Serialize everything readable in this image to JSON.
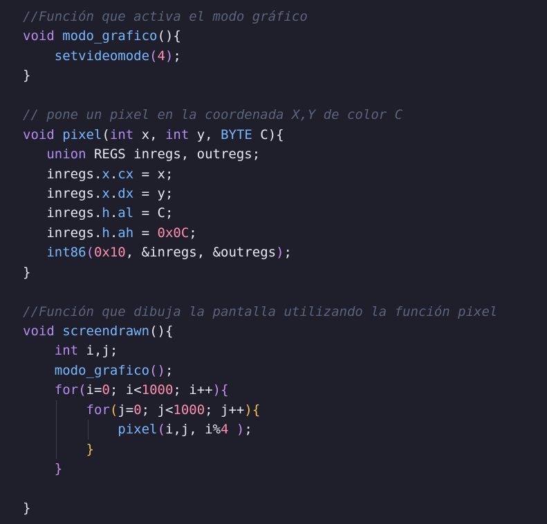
{
  "colors": {
    "background": "#1e1f2b",
    "keyword": "#b58cf0",
    "function": "#79b8ff",
    "plain": "#e6e8f2",
    "number": "#ff8fb1",
    "comment": "#5c637a",
    "paren_level1": "#c792ea",
    "paren_level2": "#f2c14e"
  },
  "code": {
    "lines": [
      {
        "indent": 0,
        "guides": [],
        "tokens": [
          {
            "t": "//Función que activa el modo gráfico",
            "k": "cm"
          }
        ]
      },
      {
        "indent": 0,
        "guides": [],
        "tokens": [
          {
            "t": "void",
            "k": "kw"
          },
          {
            "t": " ",
            "k": "pl"
          },
          {
            "t": "modo_grafico",
            "k": "fn"
          },
          {
            "t": "(){",
            "k": "pl"
          }
        ]
      },
      {
        "indent": 0,
        "guides": [],
        "tokens": [
          {
            "t": "    ",
            "k": "pl"
          },
          {
            "t": "setvideomode",
            "k": "fn"
          },
          {
            "t": "(",
            "k": "p1"
          },
          {
            "t": "4",
            "k": "num"
          },
          {
            "t": ")",
            "k": "p1"
          },
          {
            "t": ";",
            "k": "pl"
          }
        ]
      },
      {
        "indent": 0,
        "guides": [],
        "tokens": [
          {
            "t": "}",
            "k": "pl"
          }
        ]
      },
      {
        "indent": 0,
        "guides": [],
        "tokens": []
      },
      {
        "indent": 0,
        "guides": [],
        "tokens": [
          {
            "t": "// pone un pixel en la coordenada X,Y de color C",
            "k": "cm"
          }
        ]
      },
      {
        "indent": 0,
        "guides": [],
        "tokens": [
          {
            "t": "void",
            "k": "kw"
          },
          {
            "t": " ",
            "k": "pl"
          },
          {
            "t": "pixel",
            "k": "fn"
          },
          {
            "t": "(",
            "k": "pl"
          },
          {
            "t": "int",
            "k": "kw"
          },
          {
            "t": " x, ",
            "k": "pl"
          },
          {
            "t": "int",
            "k": "kw"
          },
          {
            "t": " y, ",
            "k": "pl"
          },
          {
            "t": "BYTE",
            "k": "fn"
          },
          {
            "t": " C){",
            "k": "pl"
          }
        ]
      },
      {
        "indent": 0,
        "guides": [],
        "tokens": [
          {
            "t": "   ",
            "k": "pl"
          },
          {
            "t": "union",
            "k": "kw"
          },
          {
            "t": " REGS inregs, outregs",
            "k": "pl"
          },
          {
            "t": ";",
            "k": "pl"
          }
        ]
      },
      {
        "indent": 0,
        "guides": [],
        "tokens": [
          {
            "t": "   inregs.",
            "k": "pl"
          },
          {
            "t": "x",
            "k": "fn"
          },
          {
            "t": ".",
            "k": "pl"
          },
          {
            "t": "cx",
            "k": "fn"
          },
          {
            "t": " = x;",
            "k": "pl"
          }
        ]
      },
      {
        "indent": 0,
        "guides": [],
        "tokens": [
          {
            "t": "   inregs.",
            "k": "pl"
          },
          {
            "t": "x",
            "k": "fn"
          },
          {
            "t": ".",
            "k": "pl"
          },
          {
            "t": "dx",
            "k": "fn"
          },
          {
            "t": " = y;",
            "k": "pl"
          }
        ]
      },
      {
        "indent": 0,
        "guides": [],
        "tokens": [
          {
            "t": "   inregs.",
            "k": "pl"
          },
          {
            "t": "h",
            "k": "fn"
          },
          {
            "t": ".",
            "k": "pl"
          },
          {
            "t": "al",
            "k": "fn"
          },
          {
            "t": " = C;",
            "k": "pl"
          }
        ]
      },
      {
        "indent": 0,
        "guides": [],
        "tokens": [
          {
            "t": "   inregs.",
            "k": "pl"
          },
          {
            "t": "h",
            "k": "fn"
          },
          {
            "t": ".",
            "k": "pl"
          },
          {
            "t": "ah",
            "k": "fn"
          },
          {
            "t": " = ",
            "k": "pl"
          },
          {
            "t": "0x0C",
            "k": "num"
          },
          {
            "t": ";",
            "k": "pl"
          }
        ]
      },
      {
        "indent": 0,
        "guides": [],
        "tokens": [
          {
            "t": "   ",
            "k": "pl"
          },
          {
            "t": "int86",
            "k": "fn"
          },
          {
            "t": "(",
            "k": "p1"
          },
          {
            "t": "0x10",
            "k": "num"
          },
          {
            "t": ", &inregs, &outregs",
            "k": "pl"
          },
          {
            "t": ")",
            "k": "p1"
          },
          {
            "t": ";",
            "k": "pl"
          }
        ]
      },
      {
        "indent": 0,
        "guides": [],
        "tokens": [
          {
            "t": "}",
            "k": "pl"
          }
        ]
      },
      {
        "indent": 0,
        "guides": [],
        "tokens": []
      },
      {
        "indent": 0,
        "guides": [],
        "tokens": [
          {
            "t": "//Función que dibuja la pantalla utilizando la función pixel",
            "k": "cm"
          }
        ]
      },
      {
        "indent": 0,
        "guides": [],
        "tokens": [
          {
            "t": "void",
            "k": "kw"
          },
          {
            "t": " ",
            "k": "pl"
          },
          {
            "t": "screendrawn",
            "k": "fn"
          },
          {
            "t": "(){",
            "k": "pl"
          }
        ]
      },
      {
        "indent": 0,
        "guides": [],
        "tokens": [
          {
            "t": "    ",
            "k": "pl"
          },
          {
            "t": "int",
            "k": "kw"
          },
          {
            "t": " i,j;",
            "k": "pl"
          }
        ]
      },
      {
        "indent": 0,
        "guides": [],
        "tokens": [
          {
            "t": "    ",
            "k": "pl"
          },
          {
            "t": "modo_grafico",
            "k": "fn"
          },
          {
            "t": "()",
            "k": "p1"
          },
          {
            "t": ";",
            "k": "pl"
          }
        ]
      },
      {
        "indent": 0,
        "guides": [],
        "tokens": [
          {
            "t": "    ",
            "k": "pl"
          },
          {
            "t": "for",
            "k": "kw"
          },
          {
            "t": "(",
            "k": "p1"
          },
          {
            "t": "i=",
            "k": "pl"
          },
          {
            "t": "0",
            "k": "num"
          },
          {
            "t": "; i<",
            "k": "pl"
          },
          {
            "t": "1000",
            "k": "num"
          },
          {
            "t": "; i++",
            "k": "pl"
          },
          {
            "t": "){",
            "k": "p1"
          }
        ]
      },
      {
        "indent": 0,
        "guides": [
          1
        ],
        "tokens": [
          {
            "t": "        ",
            "k": "pl"
          },
          {
            "t": "for",
            "k": "kw"
          },
          {
            "t": "(",
            "k": "p2"
          },
          {
            "t": "j=",
            "k": "pl"
          },
          {
            "t": "0",
            "k": "num"
          },
          {
            "t": "; j<",
            "k": "pl"
          },
          {
            "t": "1000",
            "k": "num"
          },
          {
            "t": "; j++",
            "k": "pl"
          },
          {
            "t": "){",
            "k": "p2"
          }
        ]
      },
      {
        "indent": 0,
        "guides": [
          1,
          2
        ],
        "tokens": [
          {
            "t": "            ",
            "k": "pl"
          },
          {
            "t": "pixel",
            "k": "fn"
          },
          {
            "t": "(",
            "k": "p1"
          },
          {
            "t": "i,j, i%",
            "k": "pl"
          },
          {
            "t": "4",
            "k": "num"
          },
          {
            "t": " ",
            "k": "pl"
          },
          {
            "t": ")",
            "k": "p1"
          },
          {
            "t": ";",
            "k": "pl"
          }
        ]
      },
      {
        "indent": 0,
        "guides": [
          1
        ],
        "tokens": [
          {
            "t": "        ",
            "k": "pl"
          },
          {
            "t": "}",
            "k": "p2"
          }
        ]
      },
      {
        "indent": 0,
        "guides": [],
        "tokens": [
          {
            "t": "    ",
            "k": "pl"
          },
          {
            "t": "}",
            "k": "p1"
          }
        ]
      },
      {
        "indent": 0,
        "guides": [],
        "tokens": []
      },
      {
        "indent": 0,
        "guides": [],
        "tokens": [
          {
            "t": "}",
            "k": "pl"
          }
        ]
      }
    ]
  }
}
